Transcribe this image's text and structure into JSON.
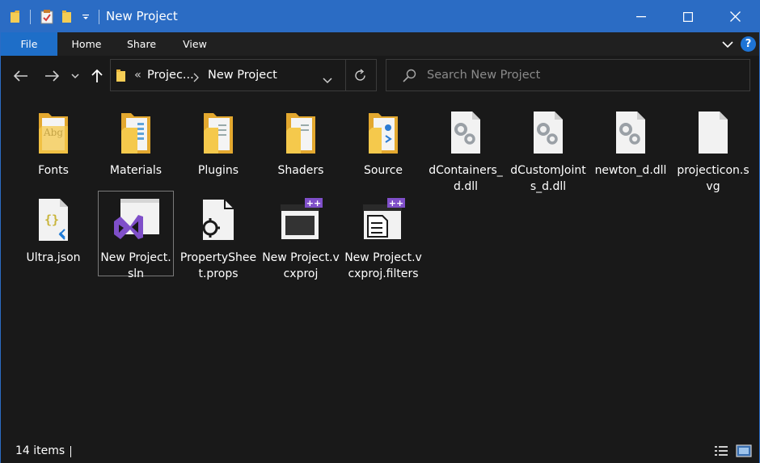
{
  "window": {
    "title": "New Project",
    "accent": "#2b6cc4",
    "background": "#191919"
  },
  "quick_access": {
    "icons": [
      "folder-icon",
      "properties-icon",
      "new-folder-icon",
      "customize-dropdown-icon"
    ]
  },
  "window_controls": {
    "minimize": "minimize-icon",
    "maximize": "maximize-icon",
    "close": "close-icon"
  },
  "ribbon": {
    "tabs": [
      "File",
      "Home",
      "Share",
      "View"
    ],
    "file_tab_color": "#1e6ec8"
  },
  "navigation": {
    "back": "back-arrow-icon",
    "forward": "forward-arrow-icon",
    "recent": "chevron-down-icon",
    "up": "up-arrow-icon"
  },
  "address": {
    "overflow": "«",
    "crumbs": [
      "Projec...",
      "New Project"
    ]
  },
  "search": {
    "placeholder": "Search New Project"
  },
  "files": [
    {
      "label": "Fonts",
      "type": "folder-fonts"
    },
    {
      "label": "Materials",
      "type": "folder-materials"
    },
    {
      "label": "Plugins",
      "type": "folder-docs"
    },
    {
      "label": "Shaders",
      "type": "folder-docs"
    },
    {
      "label": "Source",
      "type": "folder-source"
    },
    {
      "label": "dContainers_d.dll",
      "type": "dll"
    },
    {
      "label": "dCustomJoints_d.dll",
      "type": "dll"
    },
    {
      "label": "newton_d.dll",
      "type": "dll"
    },
    {
      "label": "projecticon.svg",
      "type": "blank"
    },
    {
      "label": "Ultra.json",
      "type": "json"
    },
    {
      "label": "New Project.sln",
      "type": "sln",
      "selected": true
    },
    {
      "label": "PropertySheet.props",
      "type": "props"
    },
    {
      "label": "New Project.vcxproj",
      "type": "vcxproj"
    },
    {
      "label": "New Project.vcxproj.filters",
      "type": "filters"
    }
  ],
  "status": {
    "count": "14 items"
  }
}
